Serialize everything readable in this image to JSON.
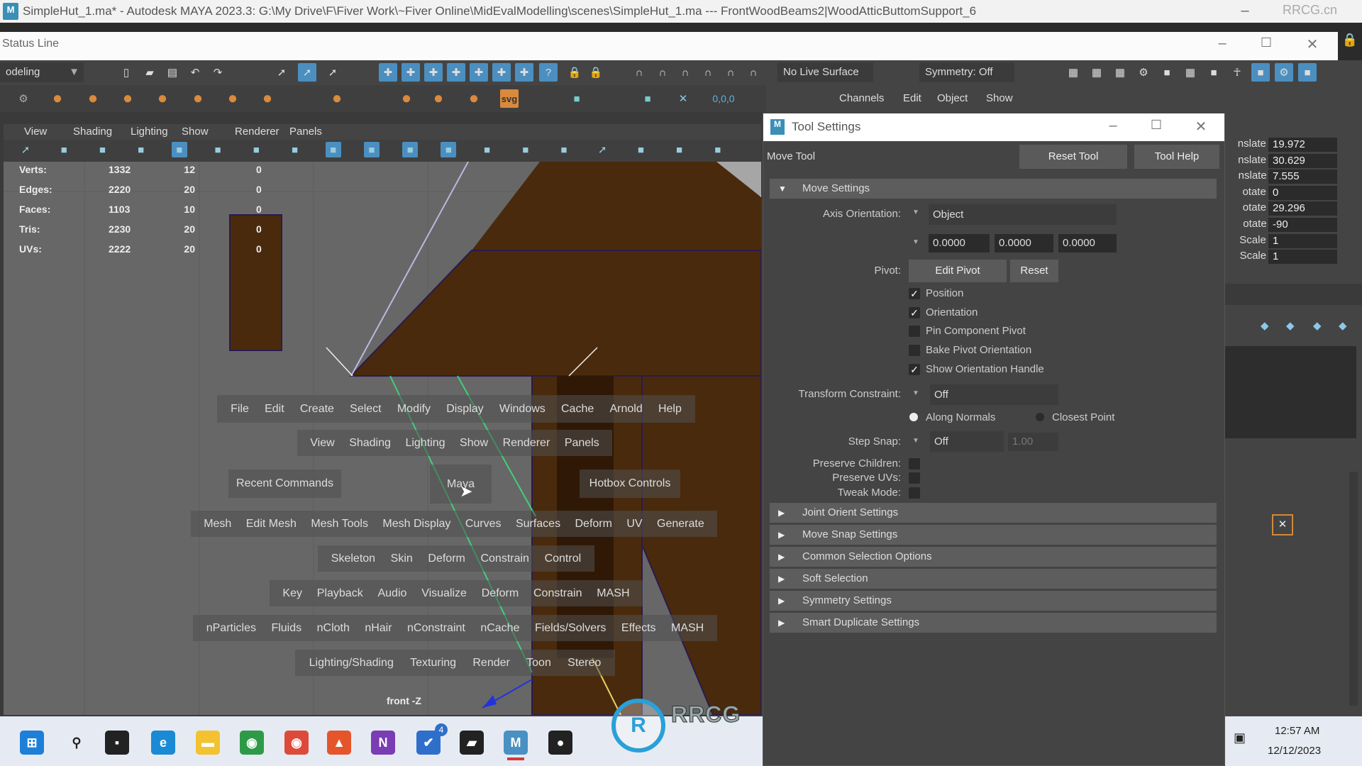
{
  "window": {
    "title": "SimpleHut_1.ma* - Autodesk MAYA 2023.3: G:\\My Drive\\F\\Fiver Work\\~Fiver Online\\MidEvalModelling\\scenes\\SimpleHut_1.ma   ---   FrontWoodBeams2|WoodAtticButtomSupport_6",
    "app_icon": "M",
    "watermark": "RRCG.cn"
  },
  "status_line": {
    "title": "Status Line",
    "menu_set": "odeling",
    "live_surface": "No Live Surface",
    "symmetry": "Symmetry: Off",
    "icons": [
      "new-scene-icon",
      "open-scene-icon",
      "save-scene-icon",
      "undo-icon",
      "redo-icon",
      "select-hierarchy-icon",
      "select-object-icon",
      "select-component-icon",
      "snap-grid-icon",
      "snap-curve-icon",
      "snap-point-icon",
      "snap-surface-icon",
      "snap-view-icon",
      "snap-live-icon",
      "snap-plane-icon",
      "help-icon",
      "lock-icon",
      "select-lock-icon",
      "magnet-icon",
      "magnet2-icon",
      "magnet3-icon",
      "magnet4-icon",
      "magnet5-icon",
      "magnet6-icon"
    ],
    "right_icons": [
      "render-view-icon",
      "render-icon",
      "ipr-icon",
      "render-settings-icon",
      "hypershade-icon",
      "render-setup-icon",
      "modeling-toolkit-icon",
      "human-ik-icon",
      "attribute-editor-icon",
      "tool-settings-icon",
      "channel-box-icon"
    ]
  },
  "shelf": {
    "icons": [
      "settings-icon",
      "poly-sphere-icon",
      "poly-cube-icon",
      "poly-cylinder-icon",
      "poly-cone-icon",
      "poly-torus-icon",
      "poly-plane-icon",
      "poly-disc-icon",
      "poly-platonic-icon",
      "poly-pipe-icon",
      "poly-helix-icon",
      "poly-prism-icon",
      "svg-icon",
      "type-grid-icon",
      "center-pivot-icon",
      "freeze-transform-icon",
      "reset-transform-icon"
    ],
    "freeze_label": "0,0,0",
    "svg_label": "svg"
  },
  "viewport": {
    "menu": [
      "View",
      "Shading",
      "Lighting",
      "Show",
      "Renderer",
      "Panels"
    ],
    "camera_label": "front -Z",
    "hud": [
      {
        "label": "Verts:",
        "total": "1332",
        "selected": "12",
        "uv": "0"
      },
      {
        "label": "Edges:",
        "total": "2220",
        "selected": "20",
        "uv": "0"
      },
      {
        "label": "Faces:",
        "total": "1103",
        "selected": "10",
        "uv": "0"
      },
      {
        "label": "Tris:",
        "total": "2230",
        "selected": "20",
        "uv": "0"
      },
      {
        "label": "UVs:",
        "total": "2222",
        "selected": "20",
        "uv": "0"
      }
    ],
    "geometry_color": "#4a2a0c"
  },
  "hotbox": {
    "row1": [
      "File",
      "Edit",
      "Create",
      "Select",
      "Modify",
      "Display",
      "Windows",
      "Cache",
      "Arnold",
      "Help"
    ],
    "row2": [
      "View",
      "Shading",
      "Lighting",
      "Show",
      "Renderer",
      "Panels"
    ],
    "recent": "Recent Commands",
    "center": "Maya",
    "controls": "Hotbox Controls",
    "row3": [
      "Mesh",
      "Edit Mesh",
      "Mesh Tools",
      "Mesh Display",
      "Curves",
      "Surfaces",
      "Deform",
      "UV",
      "Generate"
    ],
    "row4": [
      "Skeleton",
      "Skin",
      "Deform",
      "Constrain",
      "Control"
    ],
    "row5": [
      "Key",
      "Playback",
      "Audio",
      "Visualize",
      "Deform",
      "Constrain",
      "MASH"
    ],
    "row6": [
      "nParticles",
      "Fluids",
      "nCloth",
      "nHair",
      "nConstraint",
      "nCache",
      "Fields/Solvers",
      "Effects",
      "MASH"
    ],
    "row7": [
      "Lighting/Shading",
      "Texturing",
      "Render",
      "Toon",
      "Stereo"
    ]
  },
  "tool_settings": {
    "title": "Tool Settings",
    "tool_name": "Move Tool",
    "reset_tool": "Reset Tool",
    "tool_help": "Tool Help",
    "move_settings": "Move Settings",
    "axis_orientation_label": "Axis Orientation:",
    "axis_orientation": "Object",
    "axis_values": [
      "0.0000",
      "0.0000",
      "0.0000"
    ],
    "pivot_label": "Pivot:",
    "edit_pivot": "Edit Pivot",
    "reset": "Reset",
    "checkboxes": [
      {
        "label": "Position",
        "checked": true
      },
      {
        "label": "Orientation",
        "checked": true
      },
      {
        "label": "Pin Component Pivot",
        "checked": false
      },
      {
        "label": "Bake Pivot Orientation",
        "checked": false
      },
      {
        "label": "Show Orientation Handle",
        "checked": true
      }
    ],
    "transform_constraint_label": "Transform Constraint:",
    "transform_constraint": "Off",
    "along_normals": "Along Normals",
    "closest_point": "Closest Point",
    "step_snap_label": "Step Snap:",
    "step_snap": "Off",
    "step_value": "1.00",
    "preserve_children": "Preserve Children:",
    "preserve_uvs": "Preserve UVs:",
    "tweak_mode": "Tweak Mode:",
    "sections": [
      "Joint Orient Settings",
      "Move Snap Settings",
      "Common Selection Options",
      "Soft Selection",
      "Symmetry Settings",
      "Smart Duplicate Settings"
    ]
  },
  "channel_box": {
    "menu": [
      "Channels",
      "Edit",
      "Object",
      "Show"
    ],
    "channels": [
      {
        "label": "nslate X",
        "value": "19.972"
      },
      {
        "label": "nslate Y",
        "value": "30.629"
      },
      {
        "label": "nslate Z",
        "value": "7.555"
      },
      {
        "label": "otate X",
        "value": "0"
      },
      {
        "label": "otate Y",
        "value": "29.296"
      },
      {
        "label": "otate Z",
        "value": "-90"
      },
      {
        "label": "Scale X",
        "value": "1"
      },
      {
        "label": "Scale Y",
        "value": "1"
      }
    ]
  },
  "taskbar": {
    "icons": [
      "windows-start-icon",
      "search-icon",
      "task-view-icon",
      "edge-icon",
      "file-explorer-icon",
      "chrome-profile-icon",
      "chrome-icon",
      "brave-icon",
      "onenote-icon",
      "todo-icon",
      "sticky-notes-icon",
      "maya-icon",
      "obs-icon"
    ],
    "todo_badge": "4",
    "time": "12:57 AM",
    "date": "12/12/2023"
  },
  "logo_text": "RRCG 人人素材"
}
